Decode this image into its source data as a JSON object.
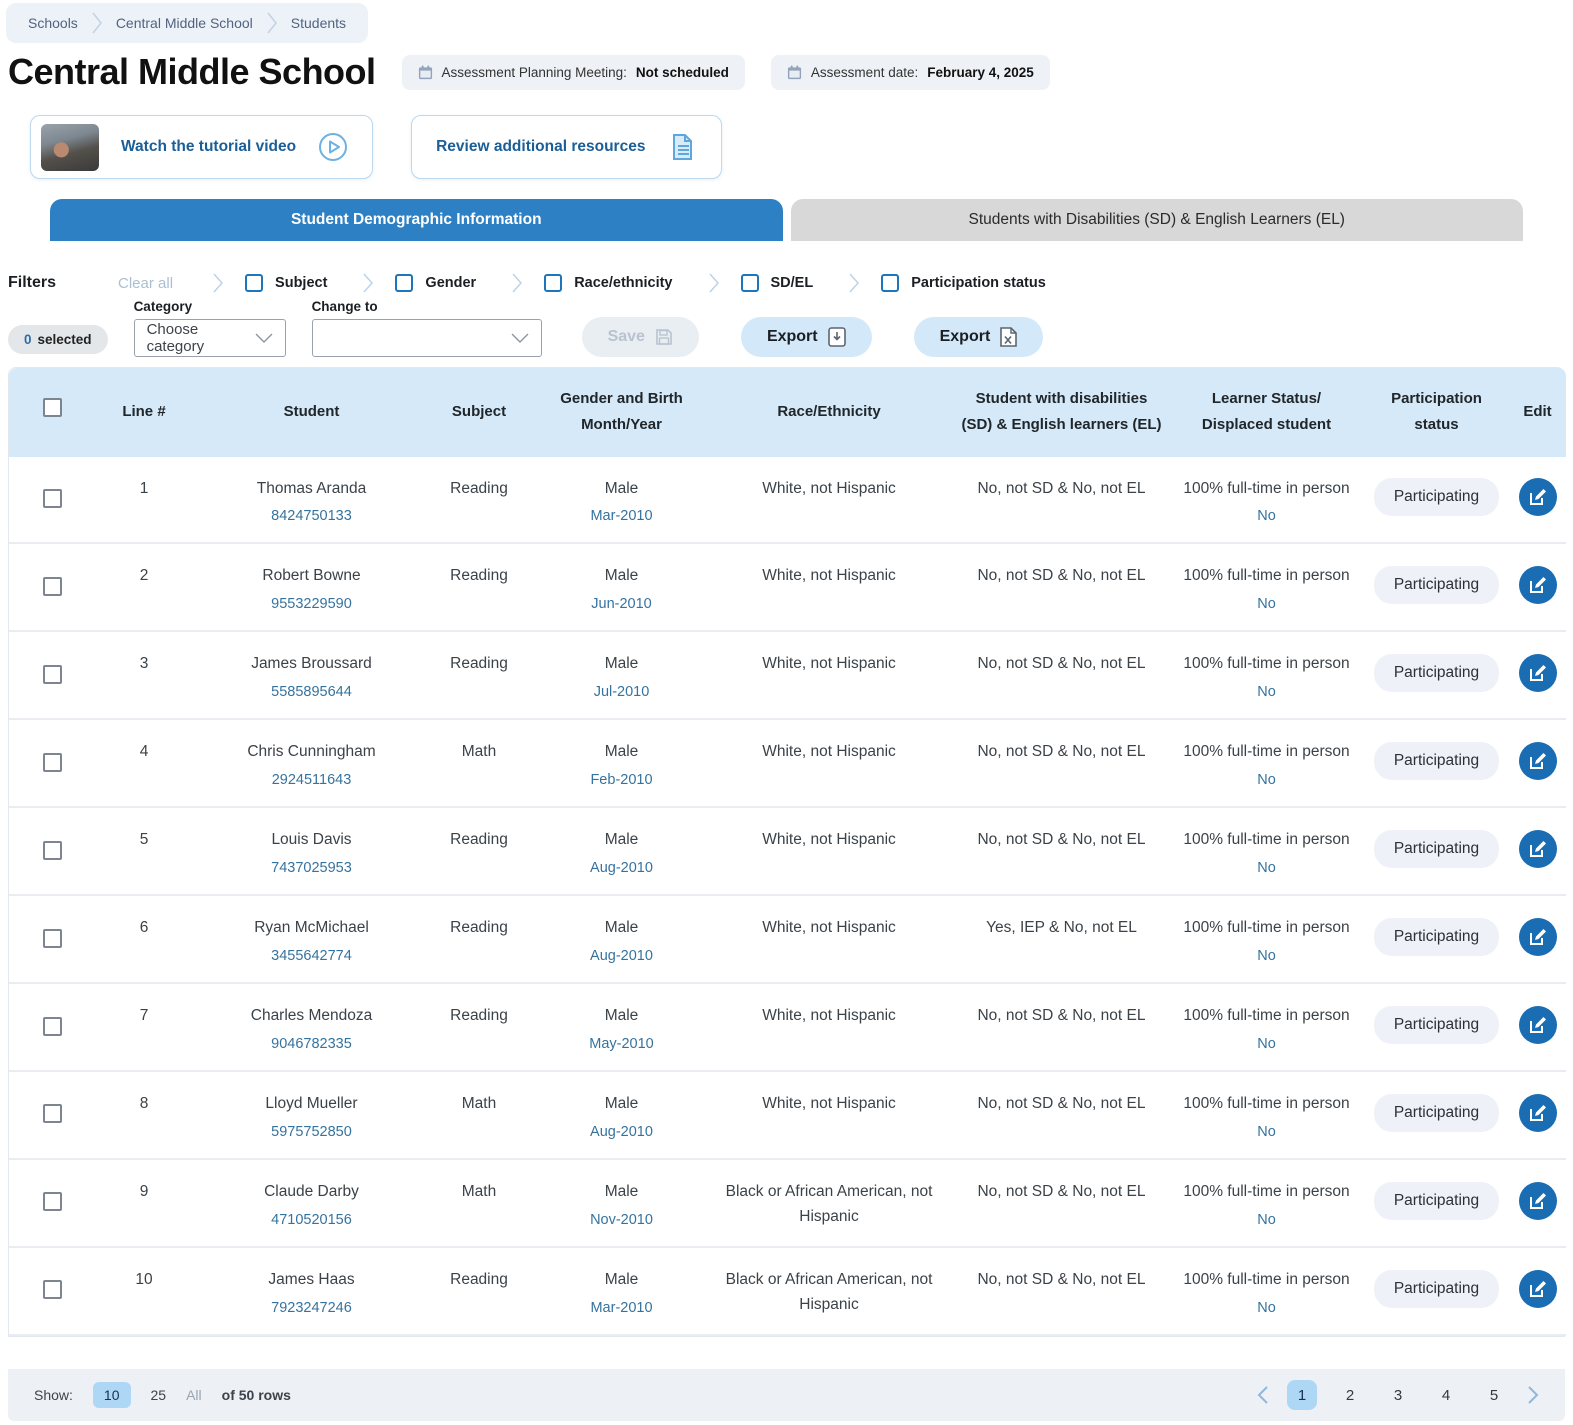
{
  "breadcrumb": {
    "items": [
      "Schools",
      "Central Middle School",
      "Students"
    ]
  },
  "header": {
    "title": "Central Middle School",
    "badges": [
      {
        "label": "Assessment Planning Meeting:",
        "value": "Not scheduled",
        "icon": "calendar-icon"
      },
      {
        "label": "Assessment date:",
        "value": "February 4, 2025",
        "icon": "calendar-icon"
      }
    ]
  },
  "actions": {
    "tutorial_label": "Watch the tutorial video",
    "resources_label": "Review additional resources"
  },
  "tabs": [
    {
      "label": "Student Demographic Information",
      "active": true
    },
    {
      "label": "Students with Disabilities (SD) & English Learners (EL)",
      "active": false
    }
  ],
  "filters": {
    "title": "Filters",
    "clear_all": "Clear all",
    "items": [
      "Subject",
      "Gender",
      "Race/ethnicity",
      "SD/EL",
      "Participation status"
    ]
  },
  "controls": {
    "selected_count": "0",
    "selected_label": "selected",
    "category_label": "Category",
    "category_value": "Choose category",
    "change_to_label": "Change to",
    "change_to_value": "",
    "save_label": "Save",
    "export_pdf_label": "Export",
    "export_excel_label": "Export"
  },
  "table": {
    "headers": [
      "Line #",
      "Student",
      "Subject",
      "Gender and Birth Month/Year",
      "Race/Ethnicity",
      "Student with disabilities (SD) & English learners (EL)",
      "Learner Status/ Displaced student",
      "Participation status",
      "Edit"
    ],
    "rows": [
      {
        "line": "1",
        "name": "Thomas Aranda",
        "id": "8424750133",
        "subject": "Reading",
        "gender": "Male",
        "birth": "Mar-2010",
        "race": "White, not Hispanic",
        "sd_el": "No, not SD & No, not EL",
        "learner_status": "100% full-time in person",
        "displaced": "No",
        "participation": "Participating"
      },
      {
        "line": "2",
        "name": "Robert Bowne",
        "id": "9553229590",
        "subject": "Reading",
        "gender": "Male",
        "birth": "Jun-2010",
        "race": "White, not Hispanic",
        "sd_el": "No, not SD & No, not EL",
        "learner_status": "100% full-time in person",
        "displaced": "No",
        "participation": "Participating"
      },
      {
        "line": "3",
        "name": "James Broussard",
        "id": "5585895644",
        "subject": "Reading",
        "gender": "Male",
        "birth": "Jul-2010",
        "race": "White, not Hispanic",
        "sd_el": "No, not SD & No, not EL",
        "learner_status": "100% full-time in person",
        "displaced": "No",
        "participation": "Participating"
      },
      {
        "line": "4",
        "name": "Chris Cunningham",
        "id": "2924511643",
        "subject": "Math",
        "gender": "Male",
        "birth": "Feb-2010",
        "race": "White, not Hispanic",
        "sd_el": "No, not SD & No, not EL",
        "learner_status": "100% full-time in person",
        "displaced": "No",
        "participation": "Participating"
      },
      {
        "line": "5",
        "name": "Louis Davis",
        "id": "7437025953",
        "subject": "Reading",
        "gender": "Male",
        "birth": "Aug-2010",
        "race": "White, not Hispanic",
        "sd_el": "No, not SD & No, not EL",
        "learner_status": "100% full-time in person",
        "displaced": "No",
        "participation": "Participating"
      },
      {
        "line": "6",
        "name": "Ryan McMichael",
        "id": "3455642774",
        "subject": "Reading",
        "gender": "Male",
        "birth": "Aug-2010",
        "race": "White, not Hispanic",
        "sd_el": "Yes, IEP & No, not EL",
        "learner_status": "100% full-time in person",
        "displaced": "No",
        "participation": "Participating"
      },
      {
        "line": "7",
        "name": "Charles Mendoza",
        "id": "9046782335",
        "subject": "Reading",
        "gender": "Male",
        "birth": "May-2010",
        "race": "White, not Hispanic",
        "sd_el": "No, not SD & No, not EL",
        "learner_status": "100% full-time in person",
        "displaced": "No",
        "participation": "Participating"
      },
      {
        "line": "8",
        "name": "Lloyd Mueller",
        "id": "5975752850",
        "subject": "Math",
        "gender": "Male",
        "birth": "Aug-2010",
        "race": "White, not Hispanic",
        "sd_el": "No, not SD & No, not EL",
        "learner_status": "100% full-time in person",
        "displaced": "No",
        "participation": "Participating"
      },
      {
        "line": "9",
        "name": "Claude Darby",
        "id": "4710520156",
        "subject": "Math",
        "gender": "Male",
        "birth": "Nov-2010",
        "race": "Black or African American, not Hispanic",
        "sd_el": "No, not SD & No, not EL",
        "learner_status": "100% full-time in person",
        "displaced": "No",
        "participation": "Participating"
      },
      {
        "line": "10",
        "name": "James Haas",
        "id": "7923247246",
        "subject": "Reading",
        "gender": "Male",
        "birth": "Mar-2010",
        "race": "Black or African American, not Hispanic",
        "sd_el": "No, not SD & No, not EL",
        "learner_status": "100% full-time in person",
        "displaced": "No",
        "participation": "Participating"
      }
    ]
  },
  "footer": {
    "show_label": "Show:",
    "options": [
      "10",
      "25",
      "All"
    ],
    "active_option": "10",
    "rows_label": "of 50 rows",
    "pages": [
      "1",
      "2",
      "3",
      "4",
      "5"
    ],
    "active_page": "1"
  },
  "colors": {
    "accent_blue": "#2e80c4",
    "table_header_bg": "#d5e9f8",
    "edit_button_bg": "#1a6cb3",
    "link_blue": "#35739f",
    "export_bg": "#d3e8f9"
  }
}
